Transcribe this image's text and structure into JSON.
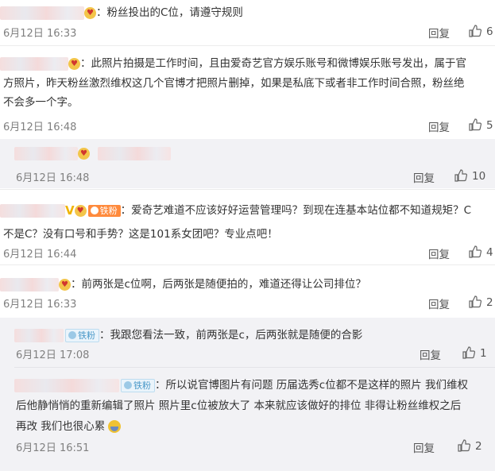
{
  "comments": [
    {
      "text_lines": [
        "：粉丝投出的C位，请遵守规则"
      ],
      "time": "6月12日 16:33",
      "reply_label": "回复",
      "likes": "6"
    },
    {
      "text_lines": [
        "：此照片拍摄是工作时间，且由爱奇艺官方娱乐账号和微博娱乐账号发出，属于官",
        "方照片，昨天粉丝激烈维权这几个官博才把照片删掉，如果是私底下或者非工作时间合照，粉丝绝",
        "不会多一个字。"
      ],
      "time": "6月12日 16:48",
      "reply_label": "回复",
      "likes": "5"
    },
    {
      "text_lines": [
        ""
      ],
      "time": "6月12日 16:48",
      "reply_label": "回复",
      "likes": "10"
    },
    {
      "badge": "铁粉",
      "text_lines": [
        "：爱奇艺难道不应该好好运营管理吗？到现在连基本站位都不知道规矩？C",
        "不是C？没有口号和手势？这是101系女团吧？专业点吧！"
      ],
      "time": "6月12日 16:44",
      "reply_label": "回复",
      "likes": "4"
    },
    {
      "text_lines": [
        "：前两张是c位啊，后两张是随便拍的，难道还得让公司排位？"
      ],
      "time": "6月12日 16:33",
      "reply_label": "回复",
      "likes": "2"
    },
    {
      "badge": "铁粉",
      "text_lines": [
        "：我跟您看法一致，前两张是c，后两张就是随便的合影"
      ],
      "time": "6月12日 17:08",
      "reply_label": "回复",
      "likes": "1"
    },
    {
      "badge": "铁粉",
      "text_lines": [
        "：所以说官博图片有问题 历届选秀c位都不是这样的照片 我们维权",
        "后他静悄悄的重新编辑了照片 照片里c位被放大了 本来就应该做好的排位 非得让粉丝维权之后",
        "再改 我们也很心累"
      ],
      "time": "6月12日 16:51",
      "reply_label": "回复",
      "likes": "2"
    }
  ],
  "colors": {
    "badge_orange": "#ff8a3c",
    "badge_blue": "#4a98c8",
    "vip": "#f0b400"
  },
  "icons": {
    "like": "thumbs-up-icon",
    "emoji": "heart-eyes-emoji",
    "tired": "tired-face-emoji"
  }
}
